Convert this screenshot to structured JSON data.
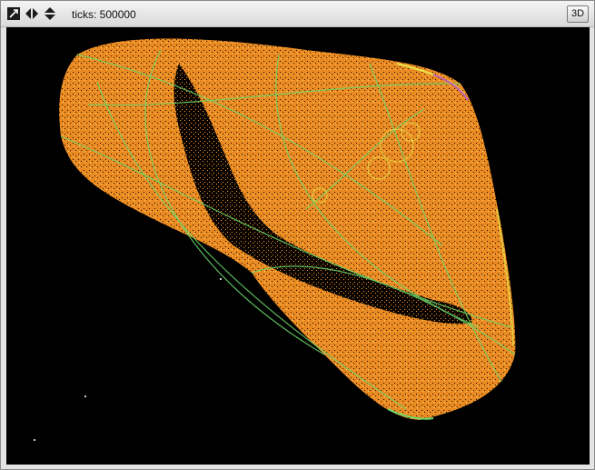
{
  "window": {
    "ticks_label": "ticks: 500000",
    "view_3d_button": "3D"
  },
  "icons": {
    "zoom": "zoom-box-icon",
    "left_right": "left-right-arrows-icon",
    "up_down": "up-down-arrows-icon"
  },
  "colors": {
    "background": "#000000",
    "primary_fill": "#f5922a",
    "highlight_green": "#6bd86b",
    "highlight_yellow": "#e8e64a",
    "highlight_magenta": "#c05ab8"
  }
}
